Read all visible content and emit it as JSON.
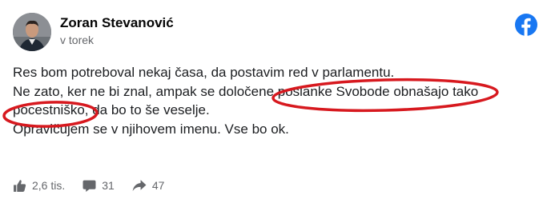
{
  "post": {
    "author": "Zoran Stevanović",
    "time": "v torek",
    "lines": [
      "Res bom potreboval nekaj časa, da postavim red v parlamentu.",
      "Ne zato, ker ne bi znal, ampak se določene poslanke Svobode obnašajo tako",
      "pocestniško, da bo to še veselje.",
      "Opravičujem se v njihovem imenu. Vse bo ok."
    ]
  },
  "icons": {
    "logo": "facebook-logo-icon",
    "like": "thumbs-up-icon",
    "comment": "comment-icon",
    "share": "share-arrow-icon"
  },
  "stats": {
    "likes": "2,6 tis.",
    "comments": "31",
    "shares": "47"
  },
  "colors": {
    "facebook_blue": "#1877f2",
    "annotation_red": "#d7191f",
    "secondary_text": "#65676b"
  }
}
